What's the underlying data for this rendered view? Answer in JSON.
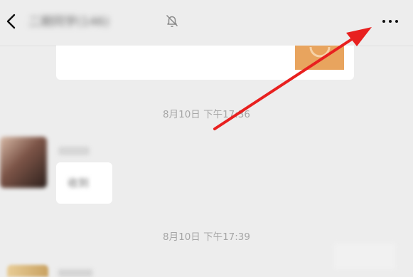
{
  "header": {
    "title": "二期同学(146)",
    "back_icon": "chevron-left-icon",
    "mute_icon": "bell-off-icon",
    "more_icon": "more-horizontal-icon"
  },
  "messages": {
    "timestamp_1": "8月10日 下午17:36",
    "timestamp_2": "8月10日 下午17:39",
    "reply_text": "收到"
  },
  "annotation": {
    "arrow_color": "#e8201f"
  }
}
